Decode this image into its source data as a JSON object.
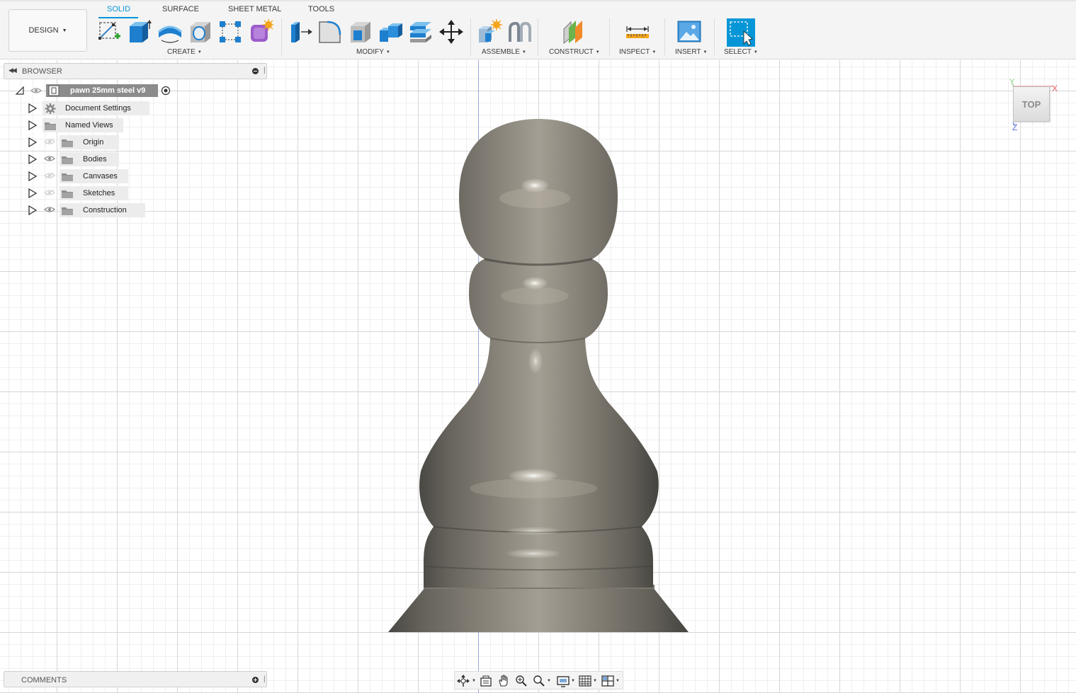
{
  "toolbar": {
    "design_label": "DESIGN",
    "tabs": [
      "SOLID",
      "SURFACE",
      "SHEET METAL",
      "TOOLS"
    ],
    "groups": {
      "create": "CREATE",
      "modify": "MODIFY",
      "assemble": "ASSEMBLE",
      "construct": "CONSTRUCT",
      "inspect": "INSPECT",
      "insert": "INSERT",
      "select": "SELECT"
    },
    "icons": {
      "create": [
        "sketch-icon",
        "extrude-icon",
        "revolve-icon",
        "hole-icon",
        "pattern-icon",
        "form-icon"
      ],
      "modify": [
        "press-pull-icon",
        "fillet-icon",
        "shell-icon",
        "combine-icon",
        "offset-plane-icon",
        "move-icon"
      ],
      "assemble": [
        "new-component-icon",
        "joint-icon"
      ],
      "construct": [
        "construct-plane-icon"
      ],
      "inspect": [
        "measure-icon"
      ],
      "insert": [
        "insert-image-icon"
      ],
      "select": [
        "select-icon"
      ]
    },
    "accent_color": "#0696d7"
  },
  "browser": {
    "title": "BROWSER",
    "root": {
      "label": "pawn 25mm steel v9"
    },
    "items": [
      {
        "label": "Document Settings",
        "icon": "gear-icon",
        "eye": "none"
      },
      {
        "label": "Named Views",
        "icon": "folder-icon",
        "eye": "none"
      },
      {
        "label": "Origin",
        "icon": "folder-icon",
        "eye": "hidden"
      },
      {
        "label": "Bodies",
        "icon": "folder-icon",
        "eye": "visible"
      },
      {
        "label": "Canvases",
        "icon": "folder-icon",
        "eye": "hidden"
      },
      {
        "label": "Sketches",
        "icon": "folder-icon",
        "eye": "hidden"
      },
      {
        "label": "Construction",
        "icon": "folder-icon",
        "eye": "visible"
      }
    ]
  },
  "comments": {
    "title": "COMMENTS"
  },
  "viewcube": {
    "face": "TOP",
    "axis_x": "X",
    "axis_y": "Y",
    "axis_z": "Z"
  },
  "navbar": {
    "icons": [
      "orbit-icon",
      "look-at-icon",
      "pan-icon",
      "zoom-window-icon",
      "zoom-icon",
      "display-settings-icon",
      "grid-icon",
      "viewports-icon"
    ]
  },
  "model": {
    "name": "pawn",
    "material_color": "#6f6b63"
  }
}
